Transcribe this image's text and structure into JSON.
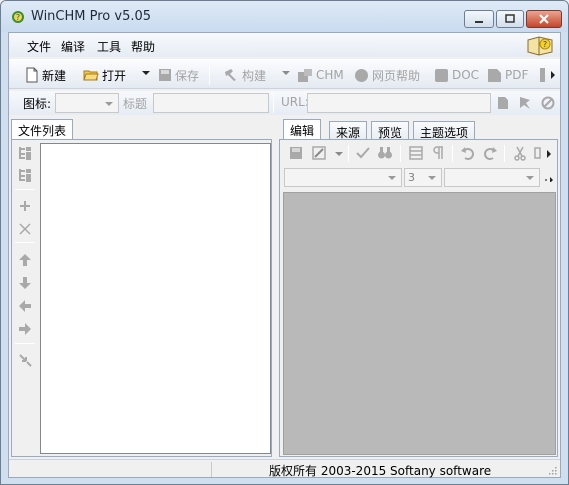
{
  "window": {
    "title": "WinCHM Pro v5.05",
    "accent_color": "#cfdff0",
    "caption_buttons": [
      "minimize",
      "maximize",
      "close"
    ]
  },
  "menu": {
    "items": [
      "文件",
      "编译",
      "工具",
      "帮助"
    ]
  },
  "toolbar": {
    "new_label": "新建",
    "open_label": "打开",
    "save_label": "保存",
    "build_label": "构建",
    "chm_label": "CHM",
    "webhelp_label": "网页帮助",
    "doc_label": "DOC",
    "pdf_label": "PDF"
  },
  "properties": {
    "icon_label": "图标:",
    "title_label": "标题",
    "url_label": "URL:",
    "icon_value": "",
    "title_value": "",
    "url_value": ""
  },
  "left_panel": {
    "tab_label": "文件列表"
  },
  "right_panel": {
    "tabs": [
      "编辑",
      "来源",
      "预览",
      "主题选项"
    ],
    "active_tab": "编辑",
    "font_name": "",
    "font_size": "3",
    "style_value": ""
  },
  "status": {
    "text": "版权所有 2003-2015 Softany software"
  },
  "icons": {
    "app": "app-icon",
    "help_book": "help-book-icon"
  }
}
